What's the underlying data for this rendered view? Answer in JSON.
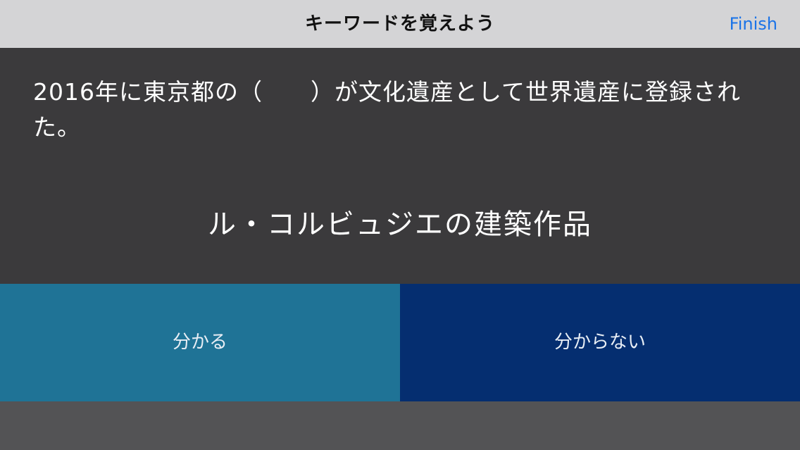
{
  "nav": {
    "title": "キーワードを覚えよう",
    "finish_label": "Finish"
  },
  "card": {
    "question": "2016年に東京都の（　　）が文化遺産として世界遺産に登録された。",
    "answer": "ル・コルビュジエの建築作品"
  },
  "actions": {
    "know_label": "分かる",
    "dont_know_label": "分からない"
  },
  "colors": {
    "nav_background": "#d4d4d6",
    "finish_text": "#1a73e8",
    "card_background": "#3b3a3c",
    "know_button": "#1f7396",
    "dont_know_button": "#052e70",
    "footer_background": "#535355"
  }
}
